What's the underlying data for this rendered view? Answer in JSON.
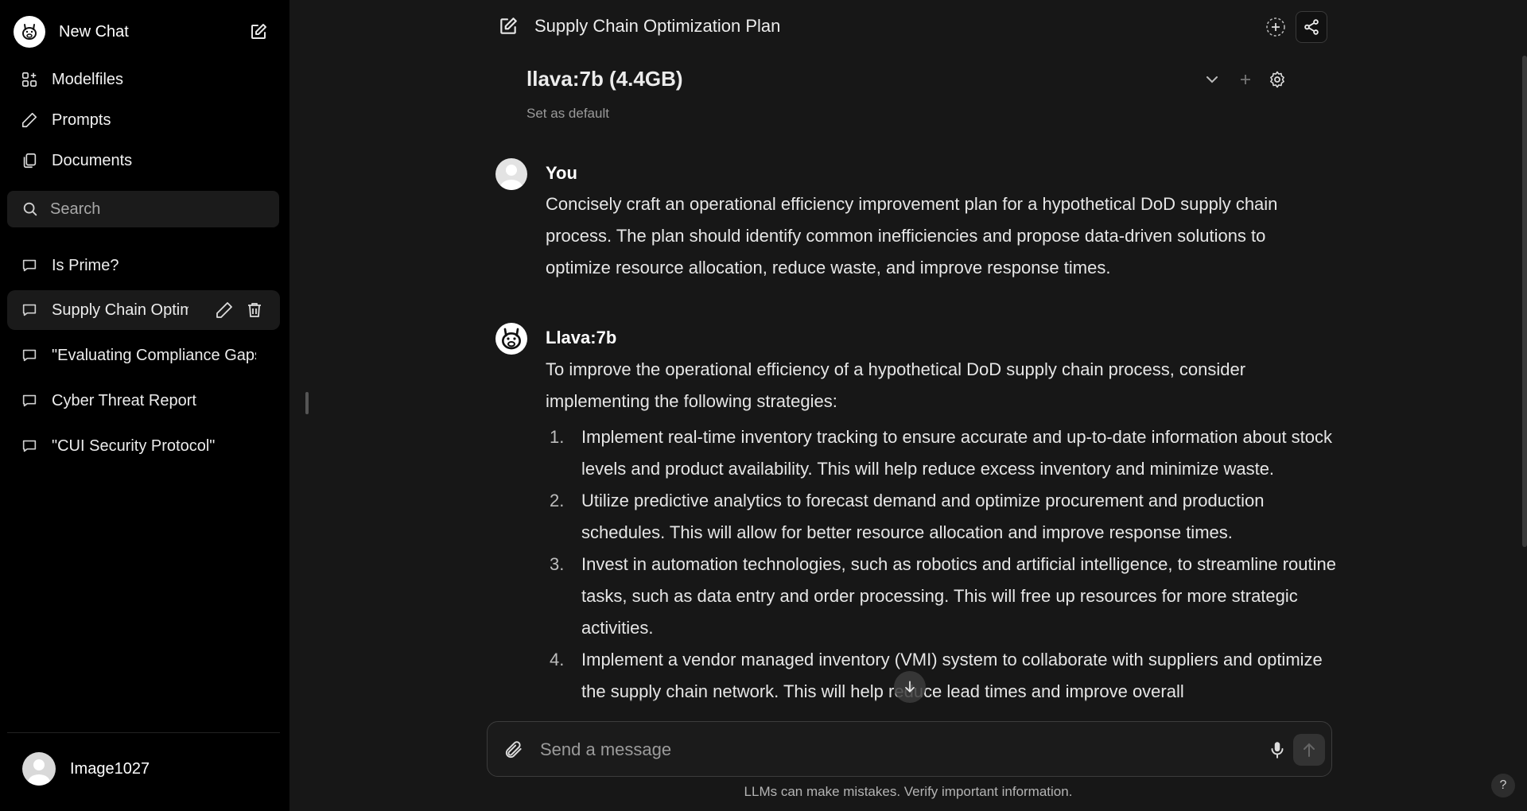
{
  "sidebar": {
    "new_chat_label": "New Chat",
    "nav": [
      {
        "label": "Modelfiles",
        "icon": "grid-plus-icon"
      },
      {
        "label": "Prompts",
        "icon": "pencil-icon"
      },
      {
        "label": "Documents",
        "icon": "documents-icon"
      }
    ],
    "search_placeholder": "Search",
    "chats": [
      {
        "label": "Is Prime?"
      },
      {
        "label": "Supply Chain Optimization Plan",
        "active": true
      },
      {
        "label": "\"Evaluating Compliance Gaps\""
      },
      {
        "label": "Cyber Threat Report"
      },
      {
        "label": "\"CUI Security Protocol\""
      }
    ],
    "user_name": "Image1027"
  },
  "header": {
    "title": "Supply Chain Optimization Plan"
  },
  "model": {
    "name": "llava:7b (4.4GB)",
    "set_default": "Set as default"
  },
  "messages": {
    "user": {
      "author": "You",
      "text": "Concisely craft an operational efficiency improvement plan for a hypothetical DoD supply chain process. The plan should identify common inefficiencies and propose data-driven solutions to optimize resource allocation, reduce waste, and improve response times."
    },
    "assistant": {
      "author": "Llava:7b",
      "intro": "To improve the operational efficiency of a hypothetical DoD supply chain process, consider implementing the following strategies:",
      "items": [
        {
          "num": "1.",
          "text": "Implement real-time inventory tracking to ensure accurate and up-to-date information about stock levels and product availability. This will help reduce excess inventory and minimize waste."
        },
        {
          "num": "2.",
          "text": "Utilize predictive analytics to forecast demand and optimize procurement and production schedules. This will allow for better resource allocation and improve response times."
        },
        {
          "num": "3.",
          "text": "Invest in automation technologies, such as robotics and artificial intelligence, to streamline routine tasks, such as data entry and order processing. This will free up resources for more strategic activities."
        },
        {
          "num": "4.",
          "text": "Implement a vendor managed inventory (VMI) system to collaborate with suppliers and optimize the supply chain network. This will help reduce lead times and improve overall"
        }
      ]
    }
  },
  "composer": {
    "placeholder": "Send a message"
  },
  "footer": {
    "disclaimer": "LLMs can make mistakes. Verify important information.",
    "help": "?"
  }
}
